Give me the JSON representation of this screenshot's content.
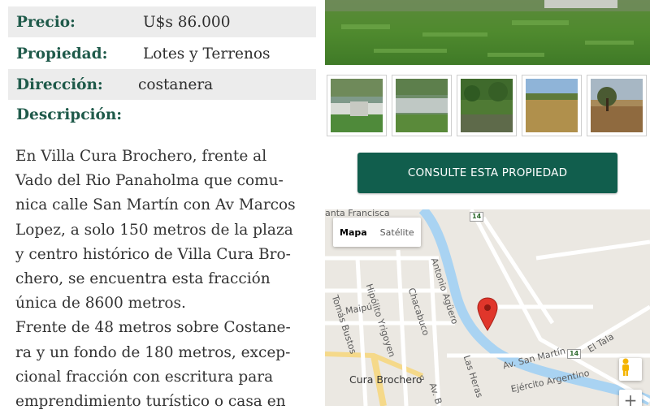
{
  "details": {
    "price_label": "Precio:",
    "price_value": "U$s 86.000",
    "property_label": "Propiedad:",
    "property_value": "Lotes y Terrenos",
    "address_label": "Dirección:",
    "address_value": "costanera",
    "description_label": "Descripción:",
    "description_lines": [
      "En Villa Cura Brochero, frente al",
      "Vado del Rio Panaholma que comu-",
      "nica calle San Martín con Av Marcos",
      "Lopez, a solo 150 metros de la plaza",
      "y centro histórico de Villa Cura Bro-",
      "chero, se encuentra esta fracción",
      "única de 8600 metros.",
      "Frente de 48 metros sobre Costane-",
      "ra y un fondo de 180 metros, excep-",
      "cional fracción con escritura para",
      "emprendimiento turístico o casa en"
    ]
  },
  "gallery": {
    "thumbnails": [
      "thumb-river-crossing",
      "thumb-river-ford",
      "thumb-trees-shore",
      "thumb-dry-field",
      "thumb-tree-field"
    ]
  },
  "cta": {
    "label": "CONSULTE ESTA PROPIEDAD"
  },
  "map": {
    "type_map": "Mapa",
    "type_satellite": "Satélite",
    "labels": {
      "santa_francisca": "anta Francisca",
      "hipolito": "Hipólito Yrigoyen",
      "antonio": "Antonio Agüero",
      "chacabuco": "Chacabuco",
      "tomas": "Tomás Bustos",
      "maipu": "Maipú",
      "san_martin": "Av. San Martín",
      "el_tala": "El Tala",
      "cura_brochero": "Cura Brochero",
      "las_heras": "Las Heras",
      "ejercito": "Ejército Argentino",
      "av_b": "Av. B"
    },
    "route_number": "14",
    "zoom_in": "+",
    "colors": {
      "river": "#a9d3f2",
      "road_yellow": "#f5d98a",
      "marker": "#e0362b"
    }
  }
}
